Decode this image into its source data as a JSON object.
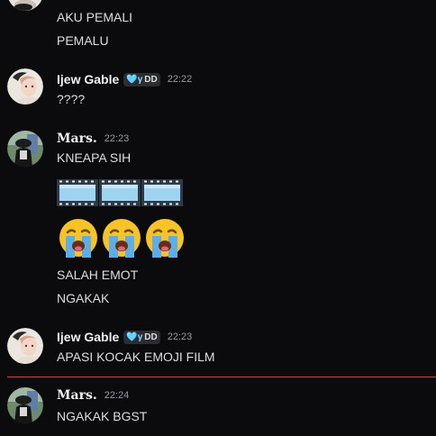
{
  "messages_top": {
    "line1": "AKU PEMALI",
    "line2": "PEMALU"
  },
  "group1": {
    "username": "Ijew Gable",
    "tag_glyph": "🩵γ",
    "tag_text": "DD",
    "timestamp": "22:22",
    "text": "????"
  },
  "group2": {
    "username": "Mars.",
    "timestamp": "22:23",
    "lines": [
      "KNEAPA SIH",
      "SALAH EMOT",
      "NGAKAK"
    ],
    "film_emoji_icon": "film-frames-icon",
    "cry_emoji_icon": "loudly-crying-face-icon"
  },
  "group3": {
    "username": "Ijew Gable",
    "tag_glyph": "🩵γ",
    "tag_text": "DD",
    "timestamp": "22:23",
    "text": "APASI KOCAK EMOJI FILM"
  },
  "group4": {
    "username": "Mars.",
    "timestamp": "22:24",
    "text": "NGAKAK BGST"
  },
  "colors": {
    "background": "#0b0b0d",
    "new_messages_divider": "#d8413c",
    "text": "#dcdde1",
    "timestamp": "#949ba4"
  }
}
